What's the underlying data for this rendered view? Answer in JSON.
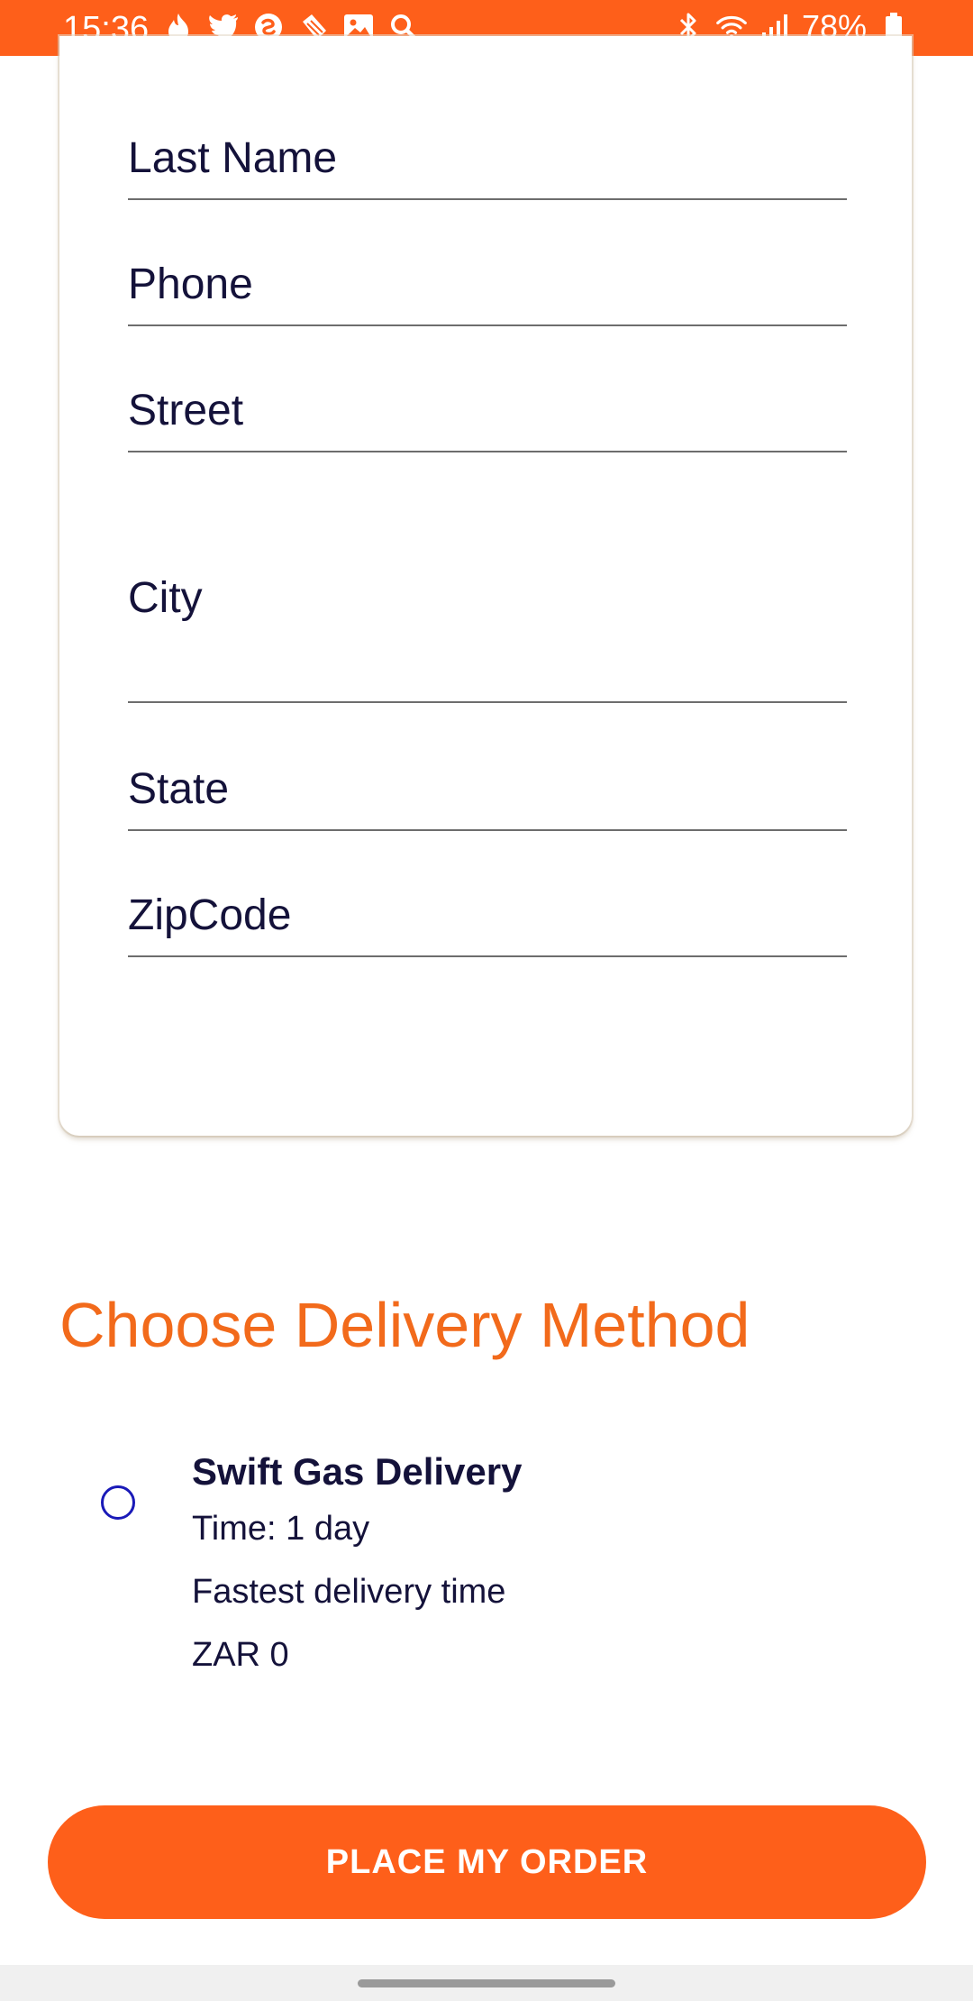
{
  "status_bar": {
    "time": "15:36",
    "battery": "78%",
    "left_icons": [
      "flame-icon",
      "twitter-icon",
      "swirl-icon",
      "tag-icon",
      "image-icon",
      "search-icon"
    ],
    "right_icons": [
      "bluetooth-icon",
      "wifi-icon",
      "signal-icon",
      "battery-icon"
    ]
  },
  "form": {
    "fields": [
      {
        "name": "last-name",
        "label": "Last Name"
      },
      {
        "name": "phone",
        "label": "Phone"
      },
      {
        "name": "street",
        "label": "Street"
      },
      {
        "name": "city",
        "label": "City"
      },
      {
        "name": "state",
        "label": "State"
      },
      {
        "name": "zipcode",
        "label": "ZipCode"
      }
    ]
  },
  "delivery": {
    "title": "Choose Delivery Method",
    "option": {
      "name": "Swift Gas Delivery",
      "time": "Time: 1 day",
      "description": "Fastest delivery time",
      "price": "ZAR 0",
      "selected": false
    }
  },
  "actions": {
    "place_order_label": "PLACE MY ORDER"
  },
  "colors": {
    "accent": "#fe5f1a",
    "title": "#f26a1b",
    "text": "#14123a",
    "radio": "#1a1ab8"
  }
}
